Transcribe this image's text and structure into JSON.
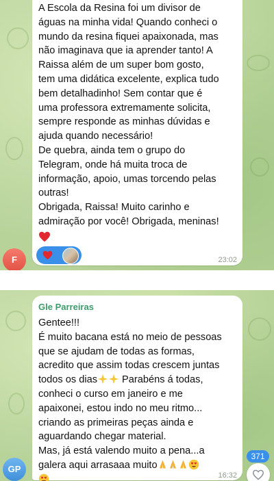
{
  "messages": [
    {
      "text_lines": [
        "A Escola da Resina foi um divisor de",
        "águas na minha vida! Quando conheci o",
        "mundo da resina fiquei apaixonada, mas",
        "não imaginava que ia aprender tanto! A",
        "Raissa além de um super bom gosto,",
        "tem uma didática excelente, explica tudo",
        "bem detalhadinho! Sem contar que é",
        "uma professora extremamente solicita,",
        "sempre responde as minhas dúvidas e",
        "ajuda quando necessário!",
        "De quebra, ainda tem o grupo do",
        "Telegram, onde há muita troca de",
        "informação, apoio, umas torcendo pelas",
        "outras!",
        "Obrigada, Raissa! Muito carinho e",
        "admiração por você! Obrigada, meninas!"
      ],
      "trailing_emoji": "red-heart-emoji",
      "reaction": {
        "emoji": "red-heart",
        "reactor": "reactor-avatar"
      },
      "time": "23:02",
      "avatar_initials": "F"
    },
    {
      "sender": "Gle Parreiras",
      "text_lines": [
        "Gentee!!!",
        "É muito bacana está no meio de pessoas",
        "que se ajudam de todas as formas,",
        "acredito que assim todas crescem juntas",
        "todos os dias",
        " Parabéns á todas,",
        "conheci o curso em janeiro e me",
        "apaixonei, estou indo no meu ritmo...",
        "criando as primeiras peças ainda e",
        "aguardando chegar material.",
        "Mas, já está valendo muito a pena...a",
        "galera aqui arrasaaa muito"
      ],
      "time": "16:32",
      "avatar_initials": "GP"
    }
  ],
  "unread_count": "371",
  "colors": {
    "chat_bg": "#b7d39a",
    "bubble": "#ffffff",
    "sender_name": "#3a9d6a",
    "accent": "#3a8fe8",
    "avatar_f": "#e8604f",
    "avatar_gp": "#4f9fe3"
  },
  "icons": [
    "red-heart-emoji",
    "sparkles-emoji",
    "folded-hands-emoji",
    "heart-eyes-emoji",
    "heart-outline-icon"
  ]
}
